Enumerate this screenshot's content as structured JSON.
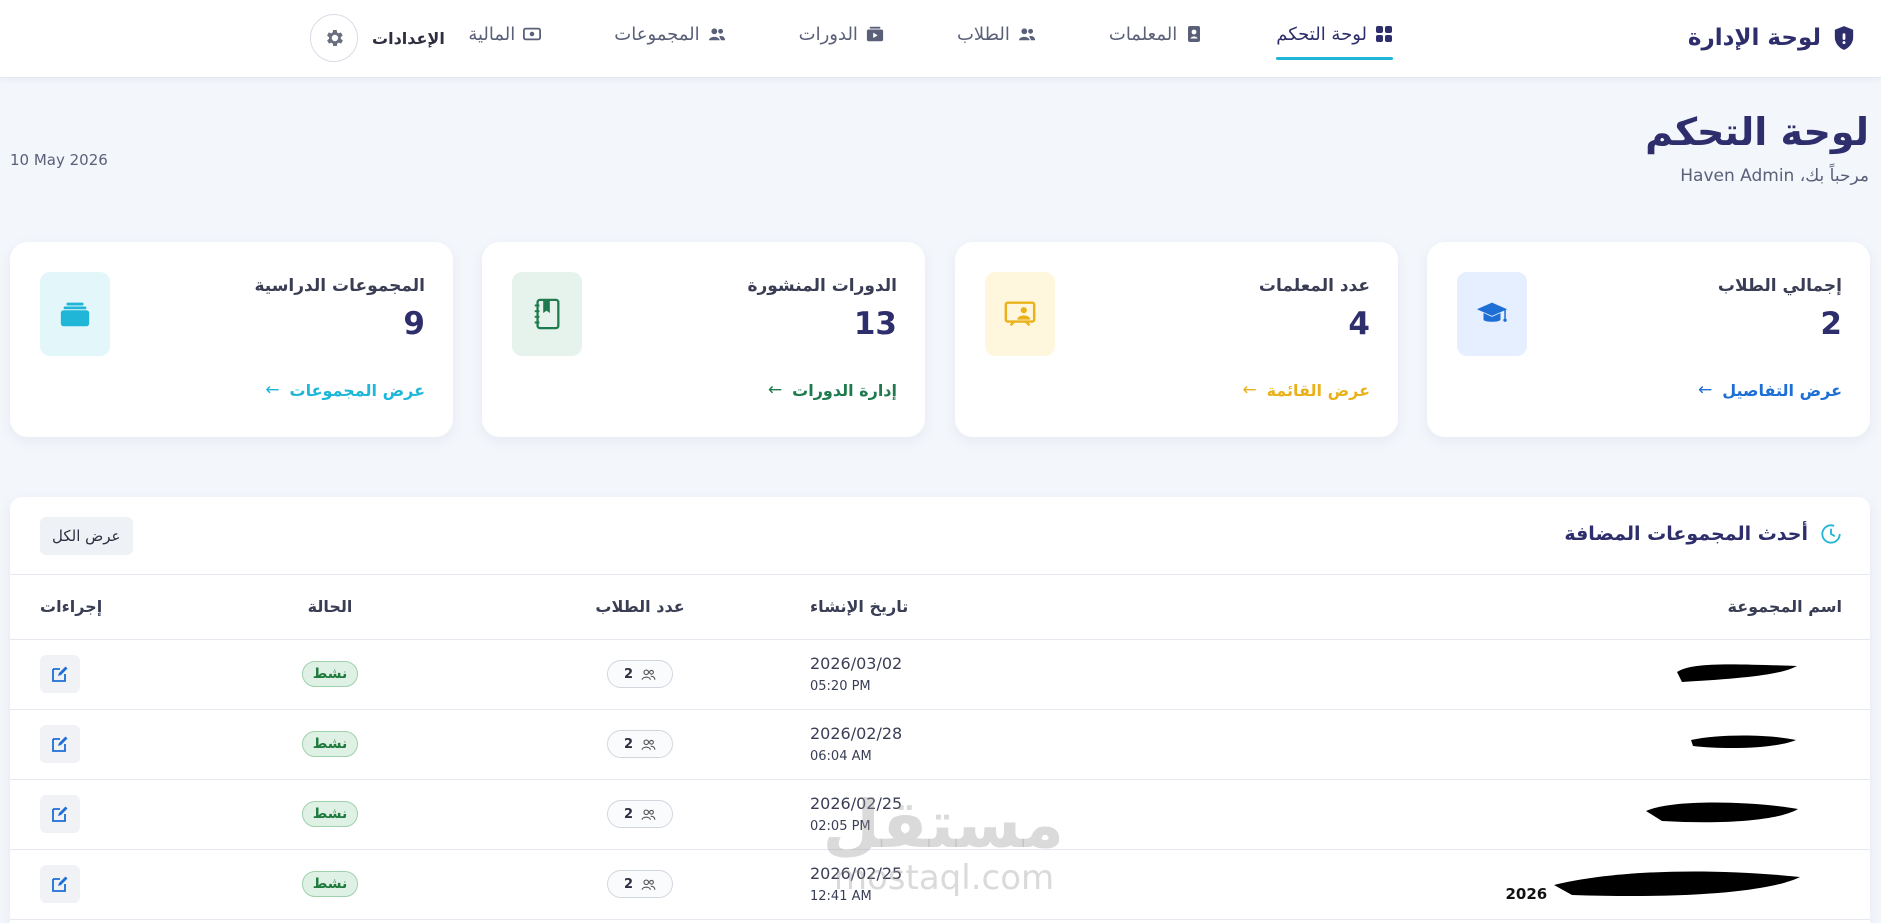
{
  "brand": {
    "title": "لوحة الإدارة"
  },
  "nav": [
    {
      "label": "لوحة التحكم",
      "icon": "grid-icon",
      "active": true
    },
    {
      "label": "المعلمات",
      "icon": "contact-book-icon",
      "active": false
    },
    {
      "label": "الطلاب",
      "icon": "users-icon",
      "active": false
    },
    {
      "label": "الدورات",
      "icon": "video-folder-icon",
      "active": false
    },
    {
      "label": "المجموعات",
      "icon": "users-icon",
      "active": false
    },
    {
      "label": "المالية",
      "icon": "money-icon",
      "active": false
    }
  ],
  "settings": {
    "label": "الإعدادات"
  },
  "header": {
    "title": "لوحة التحكم",
    "subtitle": "مرحباً بك، Haven Admin",
    "date": "10 May 2026"
  },
  "cards": [
    {
      "label": "إجمالي الطلاب",
      "value": "2",
      "link": "عرض التفاصيل",
      "arrow": "←",
      "icon": "graduation-cap-icon",
      "color": "#1d6fd6",
      "bg": "#e6efff"
    },
    {
      "label": "عدد المعلمات",
      "value": "4",
      "link": "عرض القائمة",
      "arrow": "←",
      "icon": "teacher-board-icon",
      "color": "#e9b21b",
      "bg": "#fff7dd"
    },
    {
      "label": "الدورات المنشورة",
      "value": "13",
      "link": "إدارة الدورات",
      "arrow": "←",
      "icon": "notebook-icon",
      "color": "#1f7a4e",
      "bg": "#e6f3ec"
    },
    {
      "label": "المجموعات الدراسية",
      "value": "9",
      "link": "عرض المجموعات",
      "arrow": "←",
      "icon": "layers-icon",
      "color": "#1fb6d8",
      "bg": "#e3f7fb"
    }
  ],
  "recent": {
    "title": "أحدث المجموعات المضافة",
    "view_all": "عرض الكل",
    "columns": [
      "اسم المجموعة",
      "تاريخ الإنشاء",
      "عدد الطلاب",
      "الحالة",
      "إجراءات"
    ],
    "rows": [
      {
        "date": "2026/03/02",
        "time": "05:20 PM",
        "count": "2",
        "status": "نشط",
        "extra": ""
      },
      {
        "date": "2026/02/28",
        "time": "06:04 AM",
        "count": "2",
        "status": "نشط",
        "extra": ""
      },
      {
        "date": "2026/02/25",
        "time": "02:05 PM",
        "count": "2",
        "status": "نشط",
        "extra": ""
      },
      {
        "date": "2026/02/25",
        "time": "12:41 AM",
        "count": "2",
        "status": "نشط",
        "extra": "2026"
      }
    ]
  },
  "watermark": {
    "arabic": "مستقل",
    "latin": "mostaql.com"
  },
  "colors": {
    "primary": "#2d2e6b",
    "accent": "#1fb6d8",
    "success": "#1f7a3e"
  }
}
